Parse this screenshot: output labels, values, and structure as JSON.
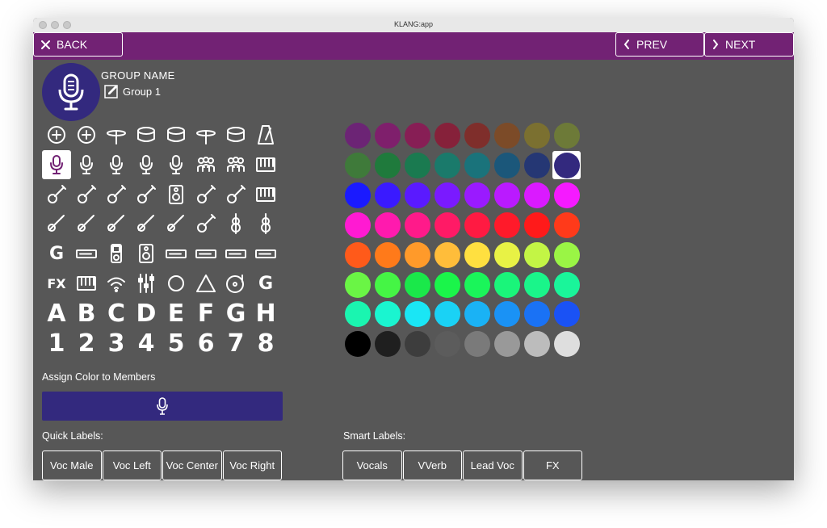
{
  "window": {
    "title": "KLANG:app"
  },
  "nav": {
    "back_label": "BACK",
    "prev_label": "PREV",
    "next_label": "NEXT",
    "bar_color": "#722274"
  },
  "group": {
    "name_heading": "GROUP NAME",
    "name_value": "Group 1",
    "color": "#33297e",
    "icon": "microphone-icon"
  },
  "icon_grid": {
    "rows": [
      [
        "audio-in-icon",
        "guiro-icon",
        "hi-hat-icon",
        "snare-drum-icon",
        "bass-drum-icon",
        "cymbal-icon",
        "drum-kit-icon",
        "metronome-icon"
      ],
      [
        "microphone-icon",
        "male-voice-icon",
        "microphone-stand-icon",
        "voice-reverb-icon",
        "condenser-mic-icon",
        "choir-small-icon",
        "choir-large-icon",
        "keyboard-stand-icon"
      ],
      [
        "electric-guitar-icon",
        "bass-guitar-icon",
        "acoustic-guitar-icon",
        "guitar-amp-icon",
        "bass-amp-icon",
        "electric-guitar-2-icon",
        "acoustic-guitar-2-icon",
        "piano-icon"
      ],
      [
        "horn-icon",
        "trombone-icon",
        "saxophone-icon",
        "flute-icon",
        "clarinet-icon",
        "banjo-icon",
        "violin-icon",
        "cello-icon"
      ],
      [
        "g-logo-icon",
        "audio-interface-icon",
        "ipod-icon",
        "speaker-icon",
        "rack-unit-1-icon",
        "rack-unit-2-icon",
        "rack-unit-3-icon",
        "cassette-icon"
      ],
      [
        "fx-icon",
        "keyboard-icon",
        "wifi-icon",
        "fader-icon",
        "drum-pad-icon",
        "triangle-icon",
        "vinyl-icon",
        "g-box-icon"
      ]
    ],
    "selected": "microphone-icon",
    "letters": [
      "A",
      "B",
      "C",
      "D",
      "E",
      "F",
      "G",
      "H"
    ],
    "numbers": [
      "1",
      "2",
      "3",
      "4",
      "5",
      "6",
      "7",
      "8"
    ]
  },
  "palette": {
    "rows": [
      [
        "#6c2475",
        "#7f1f6c",
        "#871e55",
        "#86213a",
        "#7f2e2b",
        "#7c4b28",
        "#7b7030",
        "#6d7a38"
      ],
      [
        "#3f7a3a",
        "#1f7a3c",
        "#1a7a50",
        "#1a7a6b",
        "#1a737b",
        "#1b577a",
        "#253774",
        "#33297e"
      ],
      [
        "#1a1aff",
        "#3a1aff",
        "#5a1aff",
        "#7a1aff",
        "#9a1aff",
        "#ba1aff",
        "#da1aff",
        "#f51aff"
      ],
      [
        "#ff1ad2",
        "#ff1aae",
        "#ff1a8a",
        "#ff1a66",
        "#ff1a42",
        "#ff1a2a",
        "#ff1a1a",
        "#ff3a1a"
      ],
      [
        "#ff5a1a",
        "#ff7a1a",
        "#ff9a2a",
        "#ffbd3a",
        "#ffe040",
        "#e8f245",
        "#c3f545",
        "#9af545"
      ],
      [
        "#6af545",
        "#45f545",
        "#1ae84a",
        "#1af54a",
        "#1af55a",
        "#1af57a",
        "#1af58a",
        "#1af59a"
      ],
      [
        "#1af5b0",
        "#1af5d0",
        "#1ae6f5",
        "#1ad2f5",
        "#1ab2f5",
        "#1a92f5",
        "#1a72f5",
        "#1a52f5"
      ],
      [
        "#000000",
        "#1f1f1f",
        "#3d3d3d",
        "#5c5c5c",
        "#7a7a7a",
        "#999999",
        "#bcbcbc",
        "#dedede"
      ]
    ],
    "selected": "#33297e"
  },
  "assign": {
    "label": "Assign Color to Members",
    "icon": "microphone-icon"
  },
  "quick_labels": {
    "heading": "Quick Labels:",
    "items": [
      "Voc Male",
      "Voc Left",
      "Voc Center",
      "Voc Right"
    ]
  },
  "smart_labels": {
    "heading": "Smart Labels:",
    "items": [
      "Vocals",
      "VVerb",
      "Lead Voc",
      "FX"
    ]
  }
}
